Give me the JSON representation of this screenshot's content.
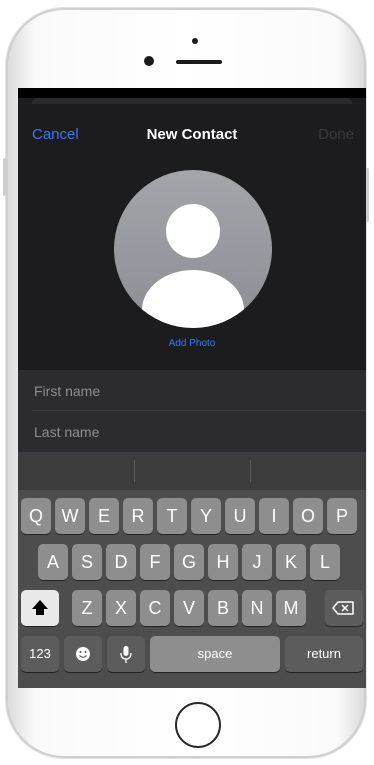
{
  "nav": {
    "cancel": "Cancel",
    "title": "New Contact",
    "done": "Done"
  },
  "avatar": {
    "add_photo": "Add Photo"
  },
  "fields": {
    "first_name_placeholder": "First name",
    "last_name_placeholder": "Last name"
  },
  "keyboard": {
    "row1": [
      "Q",
      "W",
      "E",
      "R",
      "T",
      "Y",
      "U",
      "I",
      "O",
      "P"
    ],
    "row2": [
      "A",
      "S",
      "D",
      "F",
      "G",
      "H",
      "J",
      "K",
      "L"
    ],
    "row3": [
      "Z",
      "X",
      "C",
      "V",
      "B",
      "N",
      "M"
    ],
    "numbers": "123",
    "space": "space",
    "return": "return",
    "icons": {
      "shift": "shift-icon",
      "delete": "delete-icon",
      "emoji": "emoji-icon",
      "mic": "microphone-icon"
    }
  },
  "colors": {
    "accent": "#2e7cf6",
    "screen_bg": "#1c1c1e",
    "keyboard_bg": "#4d4d4d"
  }
}
